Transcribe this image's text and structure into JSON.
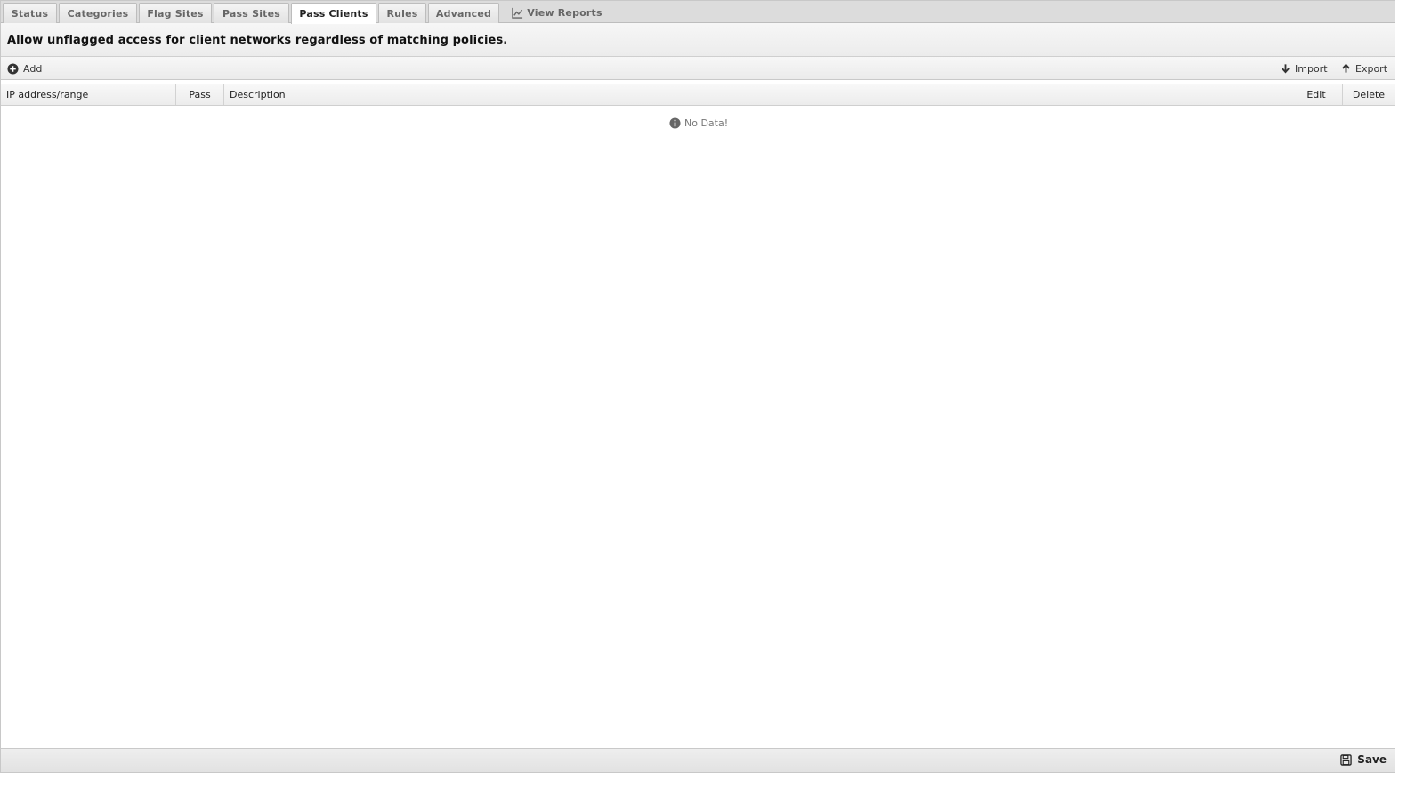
{
  "tabs": [
    {
      "label": "Status"
    },
    {
      "label": "Categories"
    },
    {
      "label": "Flag Sites"
    },
    {
      "label": "Pass Sites"
    },
    {
      "label": "Pass Clients",
      "active": true
    },
    {
      "label": "Rules"
    },
    {
      "label": "Advanced"
    },
    {
      "label": "View Reports",
      "icon": "chart-line-icon"
    }
  ],
  "description": "Allow unflagged access for client networks regardless of matching policies.",
  "toolbar": {
    "add_label": "Add",
    "import_label": "Import",
    "export_label": "Export"
  },
  "grid": {
    "columns": [
      "IP address/range",
      "Pass",
      "Description",
      "Edit",
      "Delete"
    ],
    "rows": [],
    "empty_text": "No Data!"
  },
  "footer": {
    "save_label": "Save"
  },
  "colors": {
    "tab_bar_bg": "#dcdcdc",
    "header_bg": "#ececec",
    "text": "#222222",
    "muted": "#777777"
  }
}
